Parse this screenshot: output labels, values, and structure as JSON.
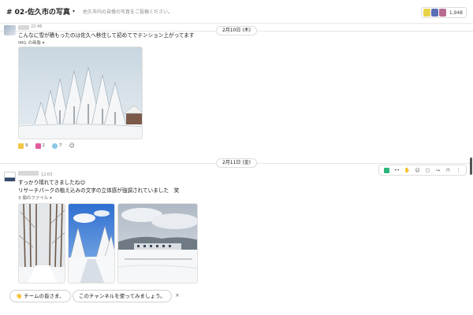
{
  "header": {
    "channel_title": "# 02-佐久市の写真",
    "topic": "佐久市内の自慢の写真をご投稿ください。",
    "member_count": "1,948"
  },
  "dates": {
    "first": "2月10日 (木)",
    "second": "2月11日 (金)"
  },
  "message1": {
    "time": "22:46",
    "text": "こんなに雪が積もったのは佐久へ移住して初めてでテンション上がってます",
    "attachment_label": "IMG の画像",
    "reactions": [
      {
        "icon": "thumbs-up-icon",
        "count": "9"
      },
      {
        "icon": "heart-icon",
        "count": "2"
      },
      {
        "icon": "sparkle-icon",
        "count": "7"
      }
    ]
  },
  "message2": {
    "time": "12:03",
    "line1": "すっかり晴れてきましたね😊",
    "line2": "リサーチパークの植え込みの文字の立体感が強調されていました　笑",
    "files_label": "3 個のファイル"
  },
  "composer": {
    "chip1": "👋 チームの皆さま、",
    "chip2": "このチャンネルを使ってみましょう。",
    "close": "×"
  },
  "colors": {
    "accent_green": "#2eb67d",
    "reaction_blue": "#1d9bd1"
  }
}
